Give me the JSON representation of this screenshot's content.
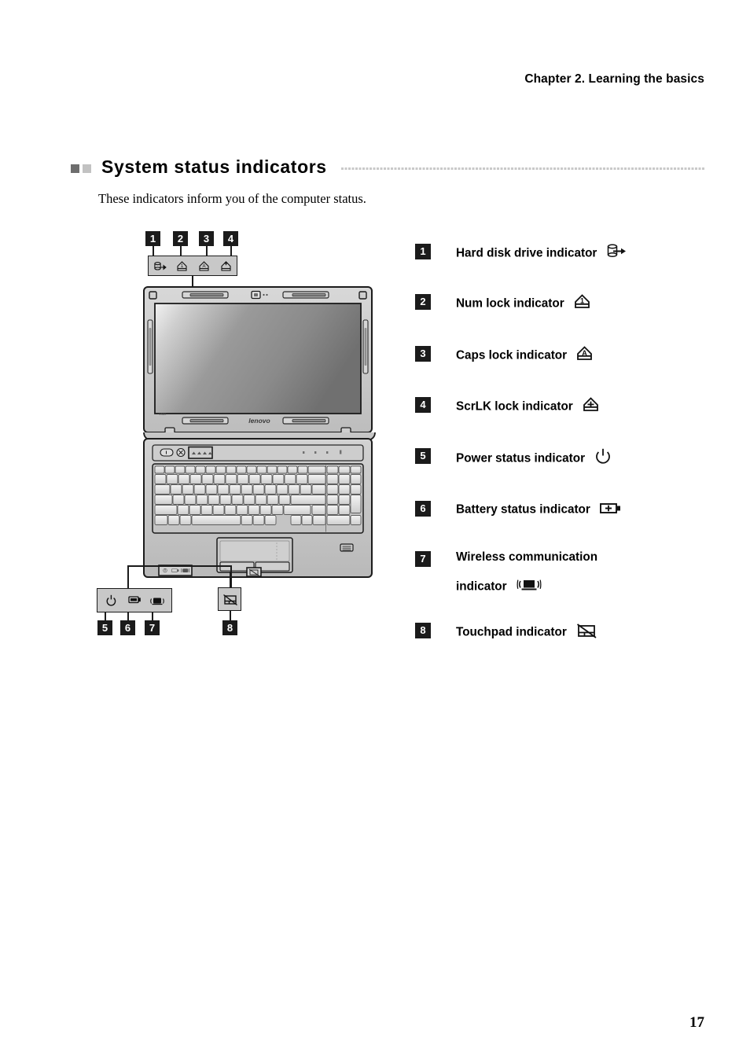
{
  "header": {
    "chapter": "Chapter 2. Learning the basics"
  },
  "section": {
    "title": "System status indicators",
    "intro": "These indicators inform you of the computer status.",
    "bullet_dark_color": "#6e6e6e",
    "bullet_light_color": "#c2c2c2",
    "rule_color": "#c9c9c9"
  },
  "legend": {
    "items": [
      {
        "number": "1",
        "label": "Hard disk drive indicator",
        "icon": "hard-disk-drive-icon"
      },
      {
        "number": "2",
        "label": "Num lock indicator",
        "icon": "num-lock-icon"
      },
      {
        "number": "3",
        "label": "Caps lock indicator",
        "icon": "caps-lock-icon"
      },
      {
        "number": "4",
        "label": "ScrLK lock indicator",
        "icon": "scroll-lock-icon"
      },
      {
        "number": "5",
        "label": "Power status indicator",
        "icon": "power-icon"
      },
      {
        "number": "6",
        "label": "Battery status indicator",
        "icon": "battery-icon"
      },
      {
        "number": "7",
        "label": "Wireless communication",
        "label_line2": "indicator",
        "icon": "wireless-icon"
      },
      {
        "number": "8",
        "label": "Touchpad indicator",
        "icon": "touchpad-icon"
      }
    ]
  },
  "diagram": {
    "brand": "lenovo",
    "top_callouts": [
      "1",
      "2",
      "3",
      "4"
    ],
    "bottom_callouts": [
      "5",
      "6",
      "7"
    ],
    "touchpad_callout": "8",
    "badge_color": "#1b1b1b",
    "indicator_bar_fill": "#c8c8c8"
  },
  "footer": {
    "page_number": "17"
  }
}
